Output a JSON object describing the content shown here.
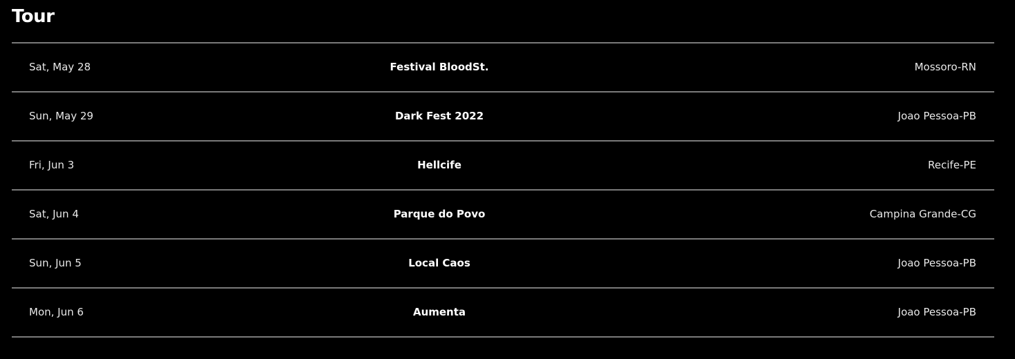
{
  "section": {
    "title": "Tour"
  },
  "events": [
    {
      "date": "Sat, May 28",
      "venue": "Festival BloodSt.",
      "location": "Mossoro-RN"
    },
    {
      "date": "Sun, May 29",
      "venue": "Dark Fest 2022",
      "location": "Joao Pessoa-PB"
    },
    {
      "date": "Fri, Jun 3",
      "venue": "Hellcife",
      "location": "Recife-PE"
    },
    {
      "date": "Sat, Jun 4",
      "venue": "Parque do Povo",
      "location": "Campina Grande-CG"
    },
    {
      "date": "Sun, Jun 5",
      "venue": "Local Caos",
      "location": "Joao Pessoa-PB"
    },
    {
      "date": "Mon, Jun 6",
      "venue": "Aumenta",
      "location": "Joao Pessoa-PB"
    }
  ],
  "colors": {
    "background": "#000000",
    "text": "#ffffff",
    "divider": "#7a7a7a"
  }
}
